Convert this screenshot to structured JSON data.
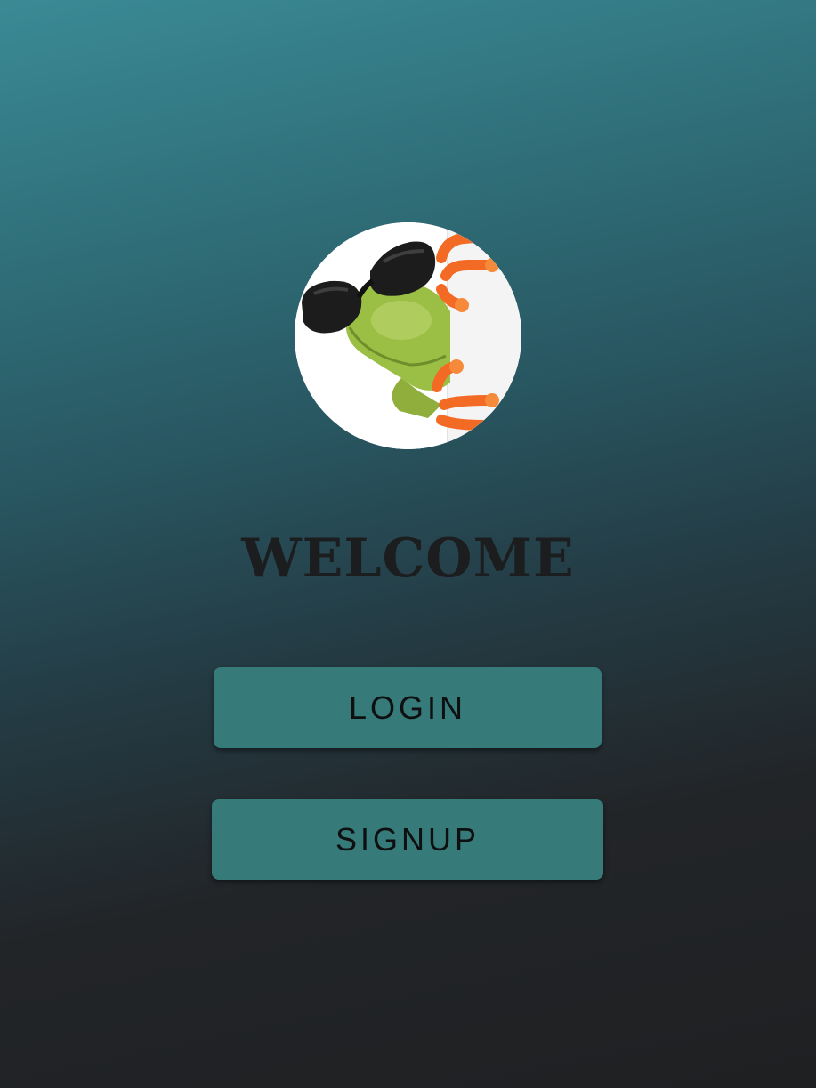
{
  "welcome": {
    "title": "WELCOME",
    "avatar_icon": "frog-sunglasses-image"
  },
  "actions": {
    "login_label": "LOGIN",
    "signup_label": "SIGNUP"
  },
  "colors": {
    "gradient_top": "#3a8a95",
    "gradient_bottom": "#1f2022",
    "button_background": "#367a7a",
    "button_text": "#0e0f10",
    "title_text": "#1c1d1f"
  }
}
